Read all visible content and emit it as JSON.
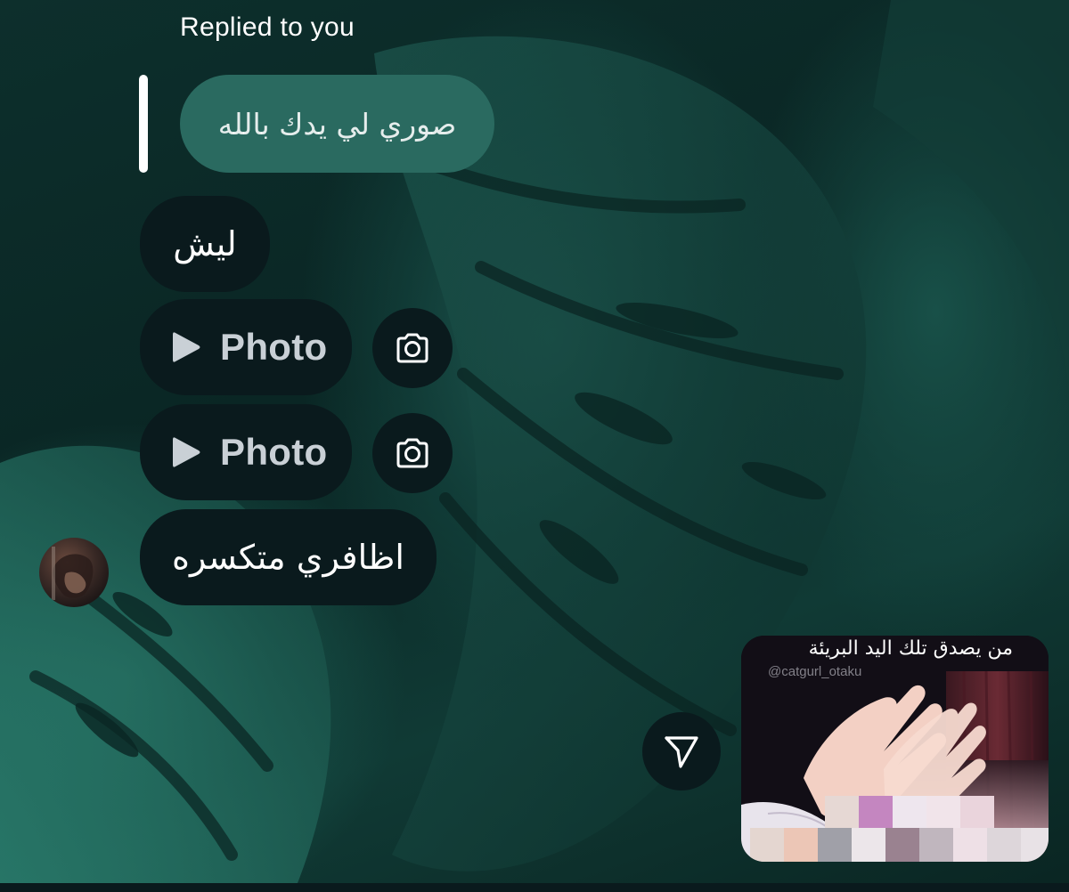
{
  "thread": {
    "reply_header": "Replied to you",
    "quoted_message": "صوري لي يدك بالله",
    "messages": [
      {
        "type": "text",
        "text": "ليش"
      },
      {
        "type": "photo",
        "label": "Photo",
        "icon": "play-icon",
        "action_icon": "camera-icon"
      },
      {
        "type": "photo",
        "label": "Photo",
        "icon": "play-icon",
        "action_icon": "camera-icon"
      },
      {
        "type": "text",
        "text": "اظافري متكسره"
      }
    ]
  },
  "shared_post": {
    "caption": "من يصدق تلك اليد البريئة",
    "handle": "@catgurl_otaku",
    "share_icon": "send-icon"
  },
  "colors": {
    "incoming_bubble": "#0a1a1d",
    "quoted_bubble": "#2a6a60",
    "background": "#0b2a28",
    "photo_label": "#c9d0d6"
  }
}
